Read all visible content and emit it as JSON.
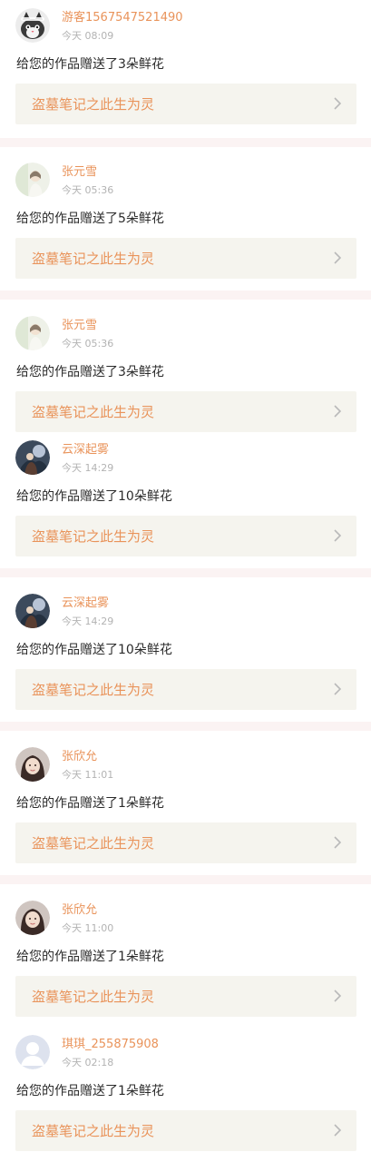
{
  "notifications": [
    {
      "user": "游客1567547521490",
      "time": "今天 08:09",
      "message": "给您的作品赠送了3朵鲜花",
      "work_title": "盗墓笔记之此生为灵",
      "avatar": "cat-avatar"
    },
    {
      "user": "张元雪",
      "time": "今天 05:36",
      "message": "给您的作品赠送了5朵鲜花",
      "work_title": "盗墓笔记之此生为灵",
      "avatar": "light-portrait-avatar"
    },
    {
      "user": "张元雪",
      "time": "今天 05:36",
      "message": "给您的作品赠送了3朵鲜花",
      "work_title": "盗墓笔记之此生为灵",
      "avatar": "light-portrait-avatar"
    },
    {
      "user": "云深起雾",
      "time": "今天 14:29",
      "message": "给您的作品赠送了10朵鲜花",
      "work_title": "盗墓笔记之此生为灵",
      "avatar": "dark-illustration-avatar"
    },
    {
      "user": "云深起雾",
      "time": "今天 14:29",
      "message": "给您的作品赠送了10朵鲜花",
      "work_title": "盗墓笔记之此生为灵",
      "avatar": "dark-illustration-avatar"
    },
    {
      "user": "张欣允",
      "time": "今天 11:01",
      "message": "给您的作品赠送了1朵鲜花",
      "work_title": "盗墓笔记之此生为灵",
      "avatar": "girl-portrait-avatar"
    },
    {
      "user": "张欣允",
      "time": "今天 11:00",
      "message": "给您的作品赠送了1朵鲜花",
      "work_title": "盗墓笔记之此生为灵",
      "avatar": "girl-portrait-avatar"
    },
    {
      "user": "琪琪_255875908",
      "time": "今天 02:18",
      "message": "给您的作品赠送了1朵鲜花",
      "work_title": "盗墓笔记之此生为灵",
      "avatar": "default-user-avatar"
    }
  ],
  "colors": {
    "accent": "#e9935a",
    "link_background": "#f5f4ee",
    "divider": "#fbf3f3",
    "time_text": "#b3b3b3",
    "message_text": "#2b2b2b"
  },
  "icons": {
    "chevron": "chevron-right-icon"
  }
}
